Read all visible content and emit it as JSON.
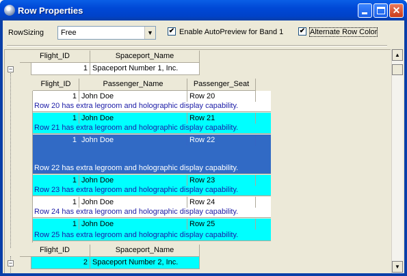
{
  "window": {
    "title": "Row Properties"
  },
  "titlebar": {
    "minimize_icon": "minimize-icon",
    "maximize_icon": "maximize-icon",
    "close_icon": "close-icon",
    "close_glyph": "✕"
  },
  "toolbar": {
    "rowsizing_label": "RowSizing",
    "rowsizing_value": "Free",
    "dropdown_arrow": "▼",
    "autopreview_label": "Enable AutoPreview for Band 1",
    "autopreview_checked": "✔",
    "altcolor_label": "Alternate Row Color",
    "altcolor_checked": "✔"
  },
  "colors": {
    "selected": "#316ac5",
    "alternate": "#00ffff",
    "normal": "#ffffff",
    "preview_text": "#1a1aa6"
  },
  "band0": {
    "headers": [
      "Flight_ID",
      "Spaceport_Name"
    ]
  },
  "band1": {
    "headers": [
      "Flight_ID",
      "Passenger_Name",
      "Passenger_Seat"
    ]
  },
  "parent_rows": [
    {
      "id": "1",
      "name": "Spaceport Number 1, Inc."
    },
    {
      "id": "2",
      "name": "Spaceport Number 2, Inc."
    }
  ],
  "child_rows": [
    {
      "id": "1",
      "name": "John Doe",
      "seat": "Row 20",
      "preview": "Row 20 has extra legroom and holographic display capability."
    },
    {
      "id": "1",
      "name": "John Doe",
      "seat": "Row 21",
      "preview": "Row 21 has extra legroom and holographic display capability."
    },
    {
      "id": "1",
      "name": "John Doe",
      "seat": "Row 22",
      "preview": "Row 22 has extra legroom and holographic display capability."
    },
    {
      "id": "1",
      "name": "John Doe",
      "seat": "Row 23",
      "preview": "Row 23 has extra legroom and holographic display capability."
    },
    {
      "id": "1",
      "name": "John Doe",
      "seat": "Row 24",
      "preview": "Row 24 has extra legroom and holographic display capability."
    },
    {
      "id": "1",
      "name": "John Doe",
      "seat": "Row 25",
      "preview": "Row 25 has extra legroom and holographic display capability."
    }
  ],
  "expander_glyph": "−",
  "scrollbar": {
    "up_arrow": "▲",
    "down_arrow": "▼"
  }
}
